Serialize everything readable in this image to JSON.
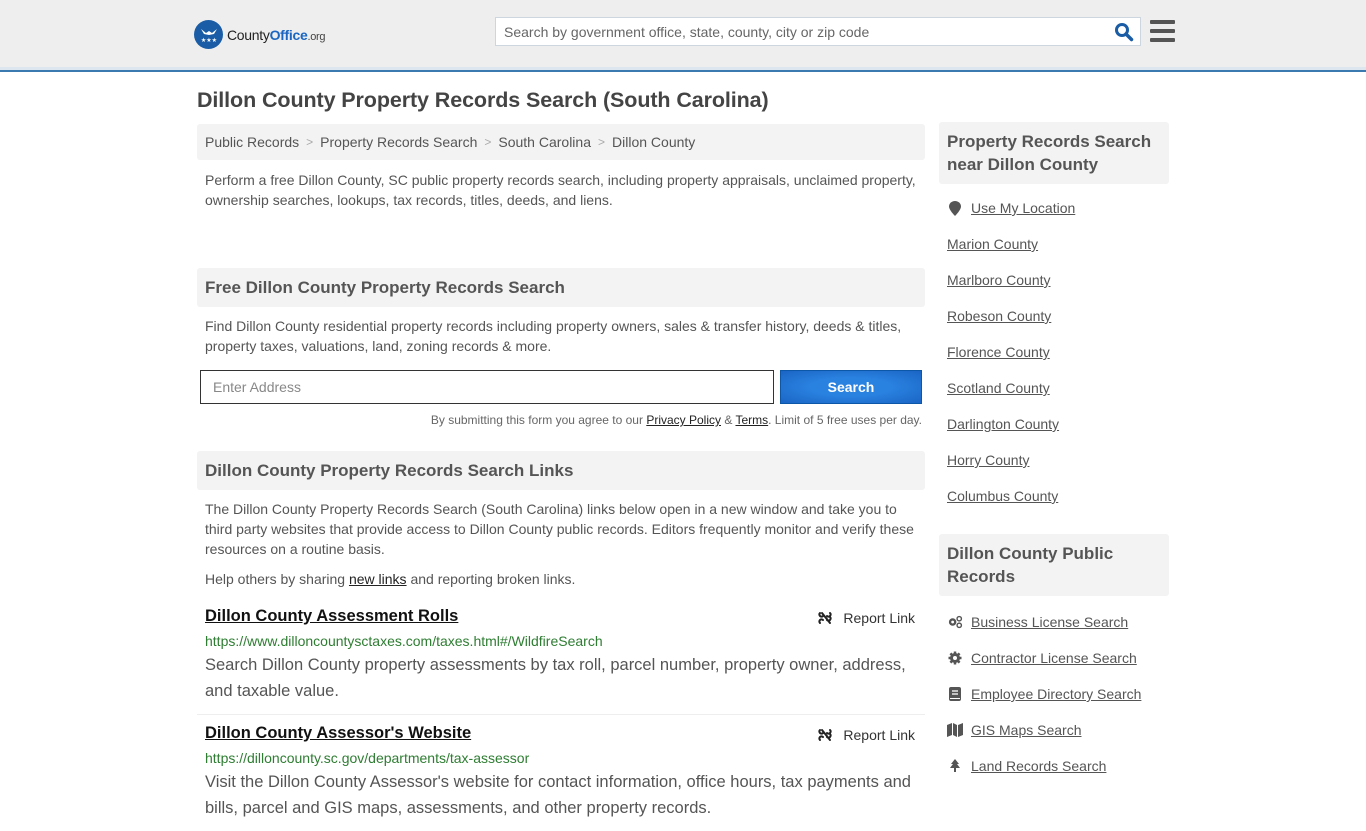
{
  "header": {
    "logo": {
      "name_part1": "County",
      "name_part2": "Office",
      "tld": ".org"
    },
    "search_placeholder": "Search by government office, state, county, city or zip code"
  },
  "page_title": "Dillon County Property Records Search (South Carolina)",
  "breadcrumb": [
    {
      "label": "Public Records"
    },
    {
      "label": "Property Records Search"
    },
    {
      "label": "South Carolina"
    },
    {
      "label": "Dillon County"
    }
  ],
  "intro": "Perform a free Dillon County, SC public property records search, including property appraisals, unclaimed property, ownership searches, lookups, tax records, titles, deeds, and liens.",
  "free_search": {
    "heading": "Free Dillon County Property Records Search",
    "description": "Find Dillon County residential property records including property owners, sales & transfer history, deeds & titles, property taxes, valuations, land, zoning records & more.",
    "input_placeholder": "Enter Address",
    "button_label": "Search",
    "disclaimer_prefix": "By submitting this form you agree to our ",
    "privacy_label": "Privacy Policy",
    "amp": " & ",
    "terms_label": "Terms",
    "disclaimer_suffix": ". Limit of 5 free uses per day."
  },
  "links_section": {
    "heading": "Dillon County Property Records Search Links",
    "description": "The Dillon County Property Records Search (South Carolina) links below open in a new window and take you to third party websites that provide access to Dillon County public records. Editors frequently monitor and verify these resources on a routine basis.",
    "help_prefix": "Help others by sharing ",
    "help_link": "new links",
    "help_suffix": " and reporting broken links.",
    "report_label": "Report Link",
    "entries": [
      {
        "title": "Dillon County Assessment Rolls",
        "url": "https://www.dilloncountysctaxes.com/taxes.html#/WildfireSearch",
        "description": "Search Dillon County property assessments by tax roll, parcel number, property owner, address, and taxable value."
      },
      {
        "title": "Dillon County Assessor's Website",
        "url": "https://dilloncounty.sc.gov/departments/tax-assessor",
        "description": "Visit the Dillon County Assessor's website for contact information, office hours, tax payments and bills, parcel and GIS maps, assessments, and other property records."
      }
    ]
  },
  "sidebar": {
    "nearby": {
      "heading": "Property Records Search near Dillon County",
      "use_location": "Use My Location",
      "counties": [
        "Marion County",
        "Marlboro County",
        "Robeson County",
        "Florence County",
        "Scotland County",
        "Darlington County",
        "Horry County",
        "Columbus County"
      ]
    },
    "public_records": {
      "heading": "Dillon County Public Records",
      "items": [
        {
          "label": "Business License Search",
          "icon": "cogs-icon"
        },
        {
          "label": "Contractor License Search",
          "icon": "gear-icon"
        },
        {
          "label": "Employee Directory Search",
          "icon": "book-icon"
        },
        {
          "label": "GIS Maps Search",
          "icon": "map-icon"
        },
        {
          "label": "Land Records Search",
          "icon": "tree-icon"
        }
      ]
    }
  }
}
